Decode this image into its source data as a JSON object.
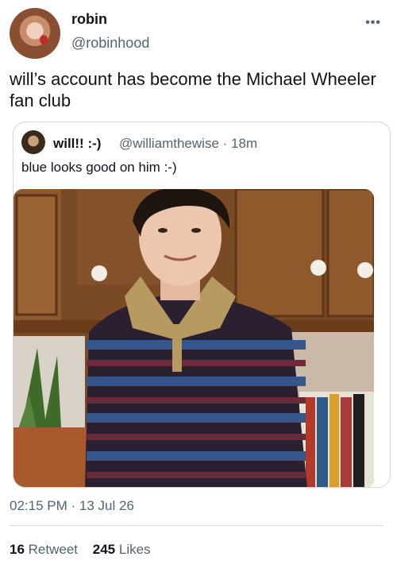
{
  "author": {
    "display_name": "robin",
    "handle": "@robinhood",
    "avatar_icon": "user-avatar"
  },
  "more_icon": "more-options-icon",
  "tweet": {
    "text": "will’s account has become the Michael Wheeler fan club"
  },
  "quoted": {
    "display_name": "will!! :-)",
    "handle": "@williamthewise",
    "separator": "·",
    "time_ago": "18m",
    "text": "blue looks good on him :-)",
    "image_alt": "photo of a smiling young man in a striped polo shirt"
  },
  "timestamp": {
    "time": "02:15 PM",
    "separator": "·",
    "date": "13 Jul 26"
  },
  "stats": {
    "retweets_count": "16",
    "retweets_label": "Retweet",
    "likes_count": "245",
    "likes_label": "Likes"
  },
  "colors": {
    "secondary_text": "#536471",
    "border": "#cfd9de",
    "primary_text": "#0f1419"
  }
}
